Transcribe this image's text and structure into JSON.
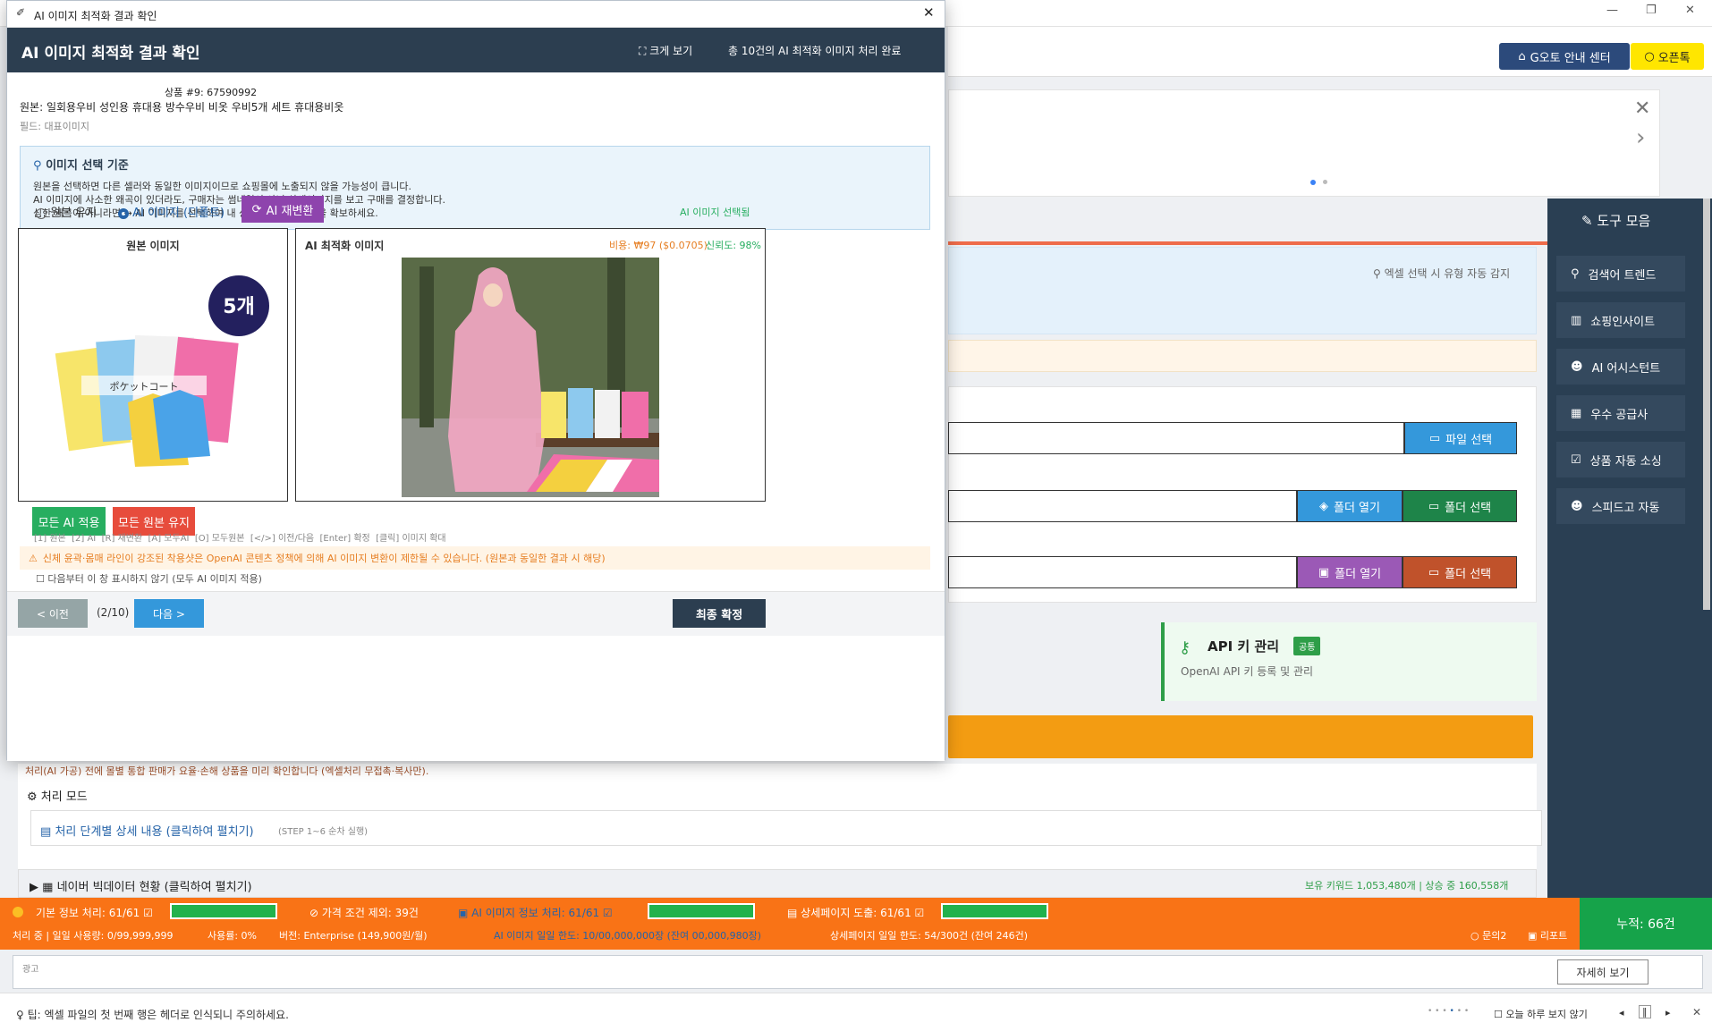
{
  "background": {
    "header": {
      "guide_btn": "G오토 안내 센터",
      "open_btn": "오픈톡"
    },
    "excel_hint": "엑셀 선택 시 유형 자동 감지",
    "file_select": "파일 선택",
    "folder_open": "폴더 열기",
    "folder_select": "폴더 선택",
    "api": {
      "title": "API 키 관리",
      "badge": "공통",
      "desc": "OpenAI API 키 등록 및 관리"
    },
    "notice": "처리(AI 가공) 전에 몰별 통합 판매가 요율·손해 상품을 미리 확인합니다 (엑셀처리 무접촉·복사만).",
    "proc_mode": "처리 모드",
    "proc_detail": "처리 단계별 상세 내용 (클릭하여 펼치기)",
    "proc_step": "(STEP 1~6 순차 실행)",
    "naver": "네이버 빅데이터 현황 (클릭하여 펼치기)",
    "naver_stats": "보유 키워드 1,053,480개 | 상승 중 160,558개"
  },
  "sidebar": {
    "title": "도구 모음",
    "items": [
      "검색어 트렌드",
      "쇼핑인사이트",
      "AI 어시스턴트",
      "우수 공급사",
      "상품 자동 소싱",
      "스피드고 자동"
    ]
  },
  "status": {
    "basic": "기본 정보 처리: 61/61",
    "price": "가격 조건 제외: 39건",
    "ai_info": "AI 이미지 정보 처리: 61/61",
    "detail": "상세페이지 도출: 61/61",
    "line2a": "처리 중 | 일일 사용량: 0/99,999,999",
    "usage_rate": "사용률: 0%",
    "version": "버전: Enterprise (149,900원/월)",
    "ai_limit": "AI 이미지 일일 한도: 10/00,000,000장 (잔여 00,000,980장)",
    "detail_limit": "상세페이지 일일 한도: 54/300건 (잔여 246건)",
    "inquiry": "문의2",
    "report": "리포트",
    "total": "누적: 66건",
    "progress": [
      1,
      1,
      1
    ]
  },
  "ad": {
    "label": "광고",
    "more_btn": "자세히 보기"
  },
  "tip": {
    "text": "팁: 엑셀 파일의 첫 번째 행은 헤더로 인식되니 주의하세요.",
    "hide_today": "오늘 하루 보지 않기"
  },
  "modal": {
    "window_title": "AI 이미지 최적화 결과 확인",
    "title": "AI 이미지 최적화 결과 확인",
    "enlarge": "크게 보기",
    "summary": "총 10건의 AI 최적화 이미지 처리 완료",
    "product_id": "상품 #9: 67590992",
    "original_name": "원본: 일회용우비 성인용 휴대용 방수우비 비옷 우비5개 세트 휴대용비옷",
    "field": "필드: 대표이미지",
    "criteria_title": "이미지 선택 기준",
    "criteria_lines": [
      "원본을 선택하면 다른 셀러와 동일한 이미지이므로 쇼핑몰에 노출되지 않을 가능성이 큽니다.",
      "AI 이미지에 사소한 왜곡이 있더라도, 구매자는 썸네일이 아닌 상세이미지를 보고 구매를 결정합니다.",
      "심한 왜곡이 아니라면 → AI 이미지를 선택하여 내 상품의 쇼핑몰 노출을 확보하세요."
    ],
    "opt_original": "원본 유지",
    "opt_ai": "AI 이미지 (디폴트)",
    "regen_btn": "AI 재변환",
    "selected_status": "AI 이미지 선택됨",
    "original_label": "원본 이미지",
    "ai_label": "AI 최적화 이미지",
    "cost": "비용: ₩97 ($0.0705)",
    "confidence": "신뢰도: 98%",
    "badge_count": "5개",
    "apply_all_ai": "모든 AI 적용",
    "keep_all_original": "모든 원본 유지",
    "shortcuts": "[1] 원본  [2] AI  [R] 재변환  [A] 모두AI  [O] 모두원본  [</>] 이전/다음  [Enter] 확정  [클릭] 이미지 확대",
    "warning": "신체 윤곽·몸매 라인이 강조된 착용샷은 OpenAI 콘텐츠 정책에 의해 AI 이미지 변환이 제한될 수 있습니다. (원본과 동일한 결과 시 해당)",
    "dont_show": "다음부터 이 창 표시하지 않기 (모두 AI 이미지 적용)",
    "prev": "< 이전",
    "page": "(2/10)",
    "next": "다음 >",
    "confirm": "최종 확정"
  },
  "colors": {
    "accent": "#2c3e50",
    "purple": "#8e44ad",
    "green": "#27ae60",
    "red": "#e74c3c",
    "orange": "#f97316"
  }
}
